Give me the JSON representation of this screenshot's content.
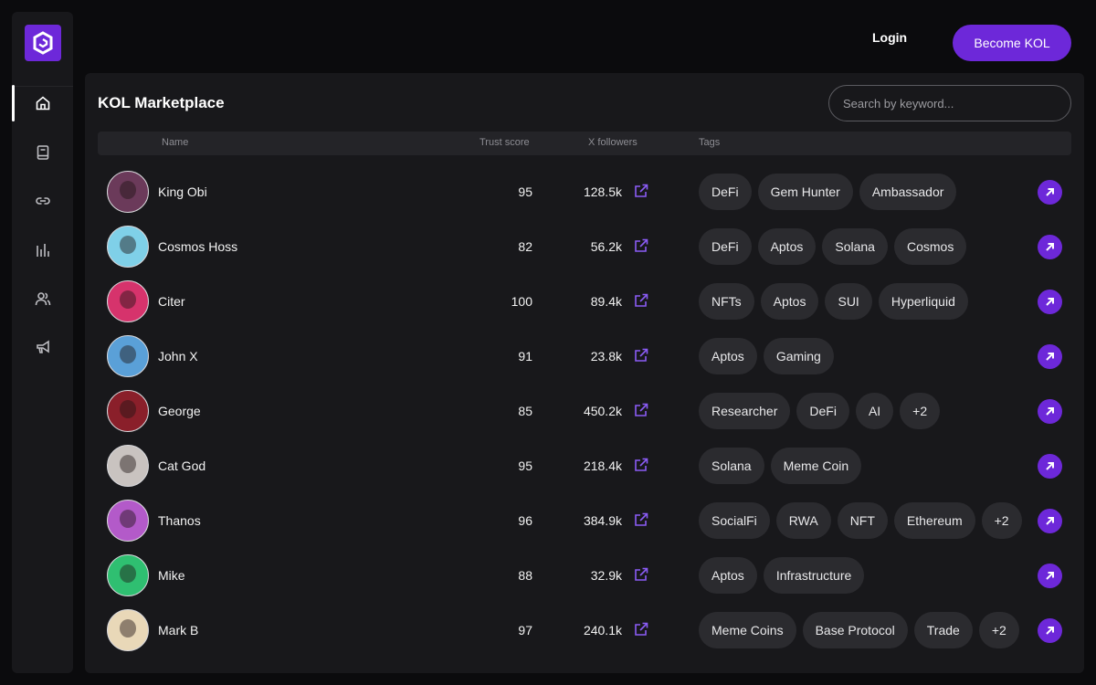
{
  "header": {
    "login_label": "Login",
    "become_label": "Become KOL"
  },
  "sidebar": {
    "items": [
      {
        "icon": "home-icon",
        "active": true
      },
      {
        "icon": "book-icon",
        "active": false
      },
      {
        "icon": "link-icon",
        "active": false
      },
      {
        "icon": "bar-chart-icon",
        "active": false
      },
      {
        "icon": "users-icon",
        "active": false
      },
      {
        "icon": "megaphone-icon",
        "active": false
      }
    ]
  },
  "main": {
    "title": "KOL Marketplace",
    "search_placeholder": "Search by keyword...",
    "columns": {
      "name": "Name",
      "trust": "Trust score",
      "followers": "X followers",
      "tags": "Tags"
    },
    "rows": [
      {
        "name": "King Obi",
        "score": "95",
        "followers": "128.5k",
        "tags": [
          "DeFi",
          "Gem Hunter",
          "Ambassador"
        ],
        "avatar_color": "#6b3a5a"
      },
      {
        "name": "Cosmos Hoss",
        "score": "82",
        "followers": "56.2k",
        "tags": [
          "DeFi",
          "Aptos",
          "Solana",
          "Cosmos"
        ],
        "avatar_color": "#7fd0e8"
      },
      {
        "name": "Citer",
        "score": "100",
        "followers": "89.4k",
        "tags": [
          "NFTs",
          "Aptos",
          "SUI",
          "Hyperliquid"
        ],
        "avatar_color": "#d6336c"
      },
      {
        "name": "John X",
        "score": "91",
        "followers": "23.8k",
        "tags": [
          "Aptos",
          "Gaming"
        ],
        "avatar_color": "#5aa0d8"
      },
      {
        "name": "George",
        "score": "85",
        "followers": "450.2k",
        "tags": [
          "Researcher",
          "DeFi",
          "AI",
          "+2"
        ],
        "avatar_color": "#8a1f2a"
      },
      {
        "name": "Cat God",
        "score": "95",
        "followers": "218.4k",
        "tags": [
          "Solana",
          "Meme Coin"
        ],
        "avatar_color": "#c9c3c0"
      },
      {
        "name": "Thanos",
        "score": "96",
        "followers": "384.9k",
        "tags": [
          "SocialFi",
          "RWA",
          "NFT",
          "Ethereum",
          "+2"
        ],
        "avatar_color": "#b35ac9"
      },
      {
        "name": "Mike",
        "score": "88",
        "followers": "32.9k",
        "tags": [
          "Aptos",
          "Infrastructure"
        ],
        "avatar_color": "#2fbf71"
      },
      {
        "name": "Mark B",
        "score": "97",
        "followers": "240.1k",
        "tags": [
          "Meme Coins",
          "Base Protocol",
          "Trade",
          "+2"
        ],
        "avatar_color": "#e9d8b8"
      }
    ]
  },
  "colors": {
    "accent": "#6d28d9",
    "tag_bg": "#2b2b2f",
    "panel_bg": "#18181b",
    "page_bg": "#0b0b0d"
  }
}
